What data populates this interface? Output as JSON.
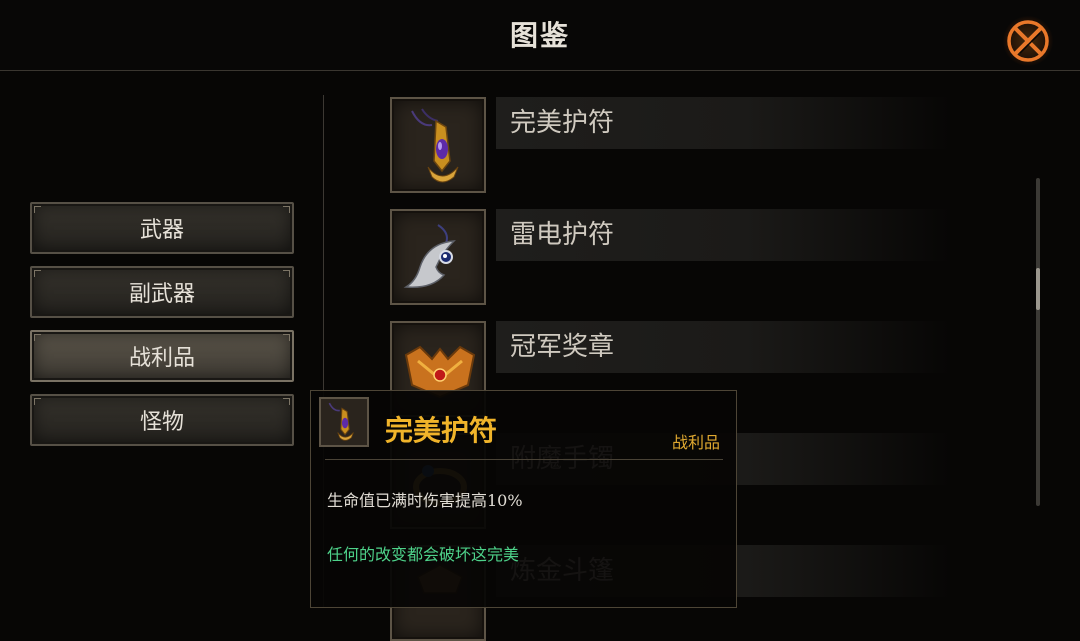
{
  "header": {
    "title": "图鉴",
    "close_icon": "close-x-circle-icon"
  },
  "categories": [
    {
      "label": "武器",
      "active": false
    },
    {
      "label": "副武器",
      "active": false
    },
    {
      "label": "战利品",
      "active": true
    },
    {
      "label": "怪物",
      "active": false
    }
  ],
  "items": [
    {
      "name": "完美护符",
      "icon": "amulet-purple-gem-icon"
    },
    {
      "name": "雷电护符",
      "icon": "crescent-amulet-icon"
    },
    {
      "name": "冠军奖章",
      "icon": "champion-medal-icon"
    },
    {
      "name": "附魔手镯",
      "icon": "enchanted-bracelet-icon"
    },
    {
      "name": "炼金斗篷",
      "icon": "alchemist-cloak-icon"
    }
  ],
  "tooltip": {
    "name": "完美护符",
    "category": "战利品",
    "description": "生命值已满时伤害提高10%",
    "flavor": "任何的改变都会破坏这完美",
    "icon": "amulet-purple-gem-icon"
  },
  "colors": {
    "accent_orange": "#e9782a",
    "item_gold": "#f0b42a",
    "flavor_green": "#4ed28a"
  }
}
